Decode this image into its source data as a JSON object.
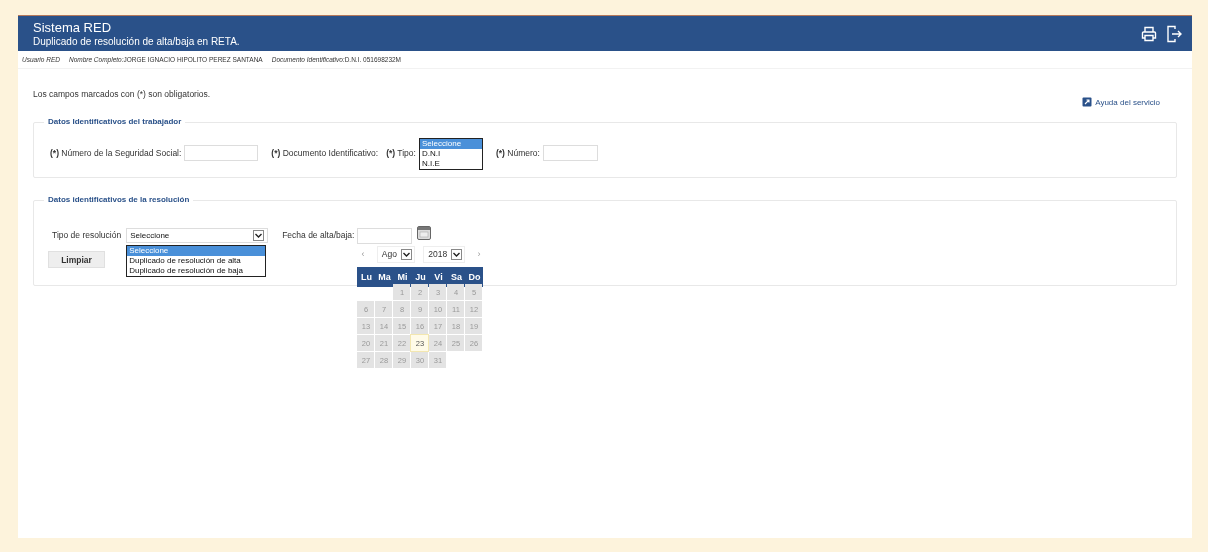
{
  "header": {
    "title": "Sistema RED",
    "subtitle": "Duplicado de resolución de alta/baja en RETA."
  },
  "user_bar": [
    {
      "label": "Usuario RED"
    },
    {
      "label": "Nombre Completo:",
      "value": "JORGE IGNACIO HIPOLITO PEREZ SANTANA"
    },
    {
      "label": "Documento Identificativo:",
      "value": "D.N.I. 051698232M"
    }
  ],
  "notice": "Los campos marcados con (*) son obligatorios.",
  "help_link": "Ayuda del servicio",
  "worker_section": {
    "legend": "Datos Identificativos del trabajador",
    "nss": {
      "mark": "(*)",
      "label": "Número de la Seguridad Social:"
    },
    "document": {
      "mark": "(*)",
      "label": "Documento Identificativo:"
    },
    "tipo": {
      "mark": "(*)",
      "label": "Tipo:",
      "options": [
        {
          "label": "Seleccione",
          "selected": true
        },
        {
          "label": "D.N.I",
          "selected": false
        },
        {
          "label": "N.I.E",
          "selected": false
        }
      ]
    },
    "numero": {
      "mark": "(*)",
      "label": "Número:"
    }
  },
  "resolution_section": {
    "legend": "Datos identificativos de la resolución",
    "type_label": "Tipo de resolución",
    "type_value": "Seleccione",
    "type_options": [
      {
        "label": "Seleccione",
        "selected": true
      },
      {
        "label": "Duplicado de resolución de alta",
        "selected": false
      },
      {
        "label": "Duplicado de resolución de baja",
        "selected": false
      }
    ],
    "date_label": "Fecha de alta/baja:",
    "clear_button": "Limpiar"
  },
  "calendar": {
    "prev": "‹",
    "next": "›",
    "month": "Ago",
    "year": "2018",
    "weekdays": [
      "Lu",
      "Ma",
      "Mi",
      "Ju",
      "Vi",
      "Sa",
      "Do"
    ],
    "days": [
      {
        "label": "1",
        "selected": false
      },
      {
        "label": "2",
        "selected": false
      },
      {
        "label": "3",
        "selected": false
      },
      {
        "label": "4",
        "selected": false
      },
      {
        "label": "5",
        "selected": false
      },
      {
        "label": "6",
        "selected": false
      },
      {
        "label": "7",
        "selected": false
      },
      {
        "label": "8",
        "selected": false
      },
      {
        "label": "9",
        "selected": false
      },
      {
        "label": "10",
        "selected": false
      },
      {
        "label": "11",
        "selected": false
      },
      {
        "label": "12",
        "selected": false
      },
      {
        "label": "13",
        "selected": false
      },
      {
        "label": "14",
        "selected": false
      },
      {
        "label": "15",
        "selected": false
      },
      {
        "label": "16",
        "selected": false
      },
      {
        "label": "17",
        "selected": false
      },
      {
        "label": "18",
        "selected": false
      },
      {
        "label": "19",
        "selected": false
      },
      {
        "label": "20",
        "selected": false
      },
      {
        "label": "21",
        "selected": false
      },
      {
        "label": "22",
        "selected": false
      },
      {
        "label": "23",
        "selected": true
      },
      {
        "label": "24",
        "selected": false
      },
      {
        "label": "25",
        "selected": false
      },
      {
        "label": "26",
        "selected": false
      },
      {
        "label": "27",
        "selected": false
      },
      {
        "label": "28",
        "selected": false
      },
      {
        "label": "29",
        "selected": false
      },
      {
        "label": "30",
        "selected": false
      },
      {
        "label": "31",
        "selected": false
      }
    ]
  }
}
